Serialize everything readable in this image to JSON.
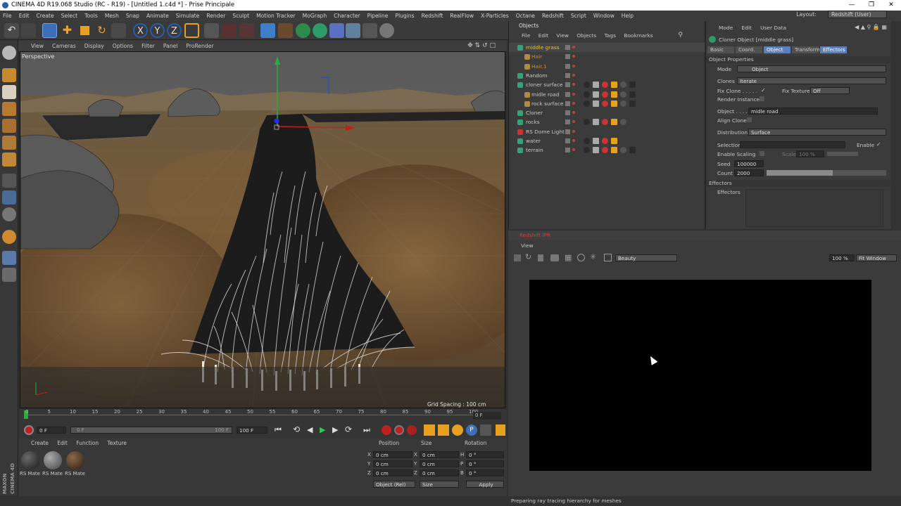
{
  "window": {
    "title": "CINEMA 4D R19.068 Studio (RC - R19) - [Untitled 1.c4d *] - Prise Principale"
  },
  "menubar": {
    "items": [
      "File",
      "Edit",
      "Create",
      "Select",
      "Tools",
      "Mesh",
      "Snap",
      "Animate",
      "Simulate",
      "Render",
      "Sculpt",
      "Motion Tracker",
      "MoGraph",
      "Character",
      "Pipeline",
      "Plugins",
      "Redshift",
      "RealFlow",
      "X-Particles",
      "Octane",
      "Redshift",
      "Script",
      "Window",
      "Help"
    ],
    "layout_label": "Layout:",
    "layout_value": "Redshift (User)"
  },
  "viewport": {
    "menu": [
      "View",
      "Cameras",
      "Display",
      "Options",
      "Filter",
      "Panel",
      "ProRender"
    ],
    "label": "Perspective",
    "grid_spacing": "Grid Spacing : 100 cm"
  },
  "timeline": {
    "ticks": [
      "0",
      "5",
      "10",
      "15",
      "20",
      "25",
      "30",
      "35",
      "40",
      "45",
      "50",
      "55",
      "60",
      "65",
      "70",
      "75",
      "80",
      "85",
      "90",
      "95",
      "100"
    ],
    "frame_display": "0 F",
    "start_field": "0 F",
    "range_start": "0 F",
    "range_end": "100 F",
    "end_field": "100 F"
  },
  "materials": {
    "menu": [
      "Create",
      "Edit",
      "Function",
      "Texture"
    ],
    "items": [
      "RS Mate",
      "RS Mate",
      "RS Mate"
    ]
  },
  "coords": {
    "headers": [
      "Position",
      "Size",
      "Rotation"
    ],
    "rows": [
      {
        "axis": "X",
        "pos": "0 cm",
        "saxis": "X",
        "size": "0 cm",
        "raxis": "H",
        "rot": "0 °"
      },
      {
        "axis": "Y",
        "pos": "0 cm",
        "saxis": "Y",
        "size": "0 cm",
        "raxis": "P",
        "rot": "0 °"
      },
      {
        "axis": "Z",
        "pos": "0 cm",
        "saxis": "Z",
        "size": "0 cm",
        "raxis": "B",
        "rot": "0 °"
      }
    ],
    "mode": "Object (Rel)",
    "size_mode": "Size",
    "apply": "Apply"
  },
  "objects": {
    "title": "Objects",
    "menu": [
      "File",
      "Edit",
      "View",
      "Objects",
      "Tags",
      "Bookmarks"
    ],
    "tree": [
      {
        "name": "middle grass",
        "color": "#e8c13a",
        "indent": 0,
        "selected": true
      },
      {
        "name": "Hair",
        "color": "#c09040",
        "indent": 1
      },
      {
        "name": "Hair.1",
        "color": "#c09040",
        "indent": 1
      },
      {
        "name": "Random",
        "color": "#c8c8c8",
        "indent": 0
      },
      {
        "name": "cloner surface",
        "color": "#c8c8c8",
        "indent": 0
      },
      {
        "name": "midle road",
        "color": "#c8c8c8",
        "indent": 1
      },
      {
        "name": "rock surface",
        "color": "#c8c8c8",
        "indent": 1
      },
      {
        "name": "Cloner",
        "color": "#c8c8c8",
        "indent": 0
      },
      {
        "name": "rocks",
        "color": "#c8c8c8",
        "indent": 0
      },
      {
        "name": "RS Dome Light",
        "color": "#c8c8c8",
        "indent": 0
      },
      {
        "name": "water",
        "color": "#c8c8c8",
        "indent": 0
      },
      {
        "name": "terrain",
        "color": "#c8c8c8",
        "indent": 0
      }
    ]
  },
  "attributes": {
    "menu": [
      "Mode",
      "Edit",
      "User Data"
    ],
    "object_title": "Cloner Object [middle grass]",
    "tabs": [
      "Basic",
      "Coord.",
      "Object",
      "Transform",
      "Effectors"
    ],
    "section": "Object Properties",
    "mode_label": "Mode",
    "mode_value": "Object",
    "clones_label": "Clones",
    "clones_value": "Iterate",
    "fix_clone": "Fix Clone . . . . .",
    "fix_texture": "Fix Texture",
    "fix_texture_value": "Off",
    "render_instances": "Render Instances",
    "object_label": "Object . . . . . . .",
    "object_value": "midle road",
    "align_clone": "Align Clone",
    "distribution_label": "Distribution",
    "distribution_value": "Surface",
    "selection_label": "Selection",
    "enable_label": "Enable",
    "enable_scaling": "Enable Scaling",
    "scale_label": "Scale",
    "scale_value": "100 %",
    "seed_label": "Seed",
    "seed_value": "100000",
    "count_label": "Count",
    "count_value": "2000",
    "count_fraction": 0.55,
    "effectors_section": "Effectors",
    "effectors_label": "Effectors"
  },
  "ipr": {
    "title": "Redshift IPR",
    "menu": "View",
    "aov": "Beauty",
    "zoom": "100 %",
    "fit": "Fit Window"
  },
  "status": {
    "text": "Preparing ray tracing hierarchy for meshes"
  },
  "side_labels": [
    "MAXON",
    "CINEMA 4D"
  ]
}
